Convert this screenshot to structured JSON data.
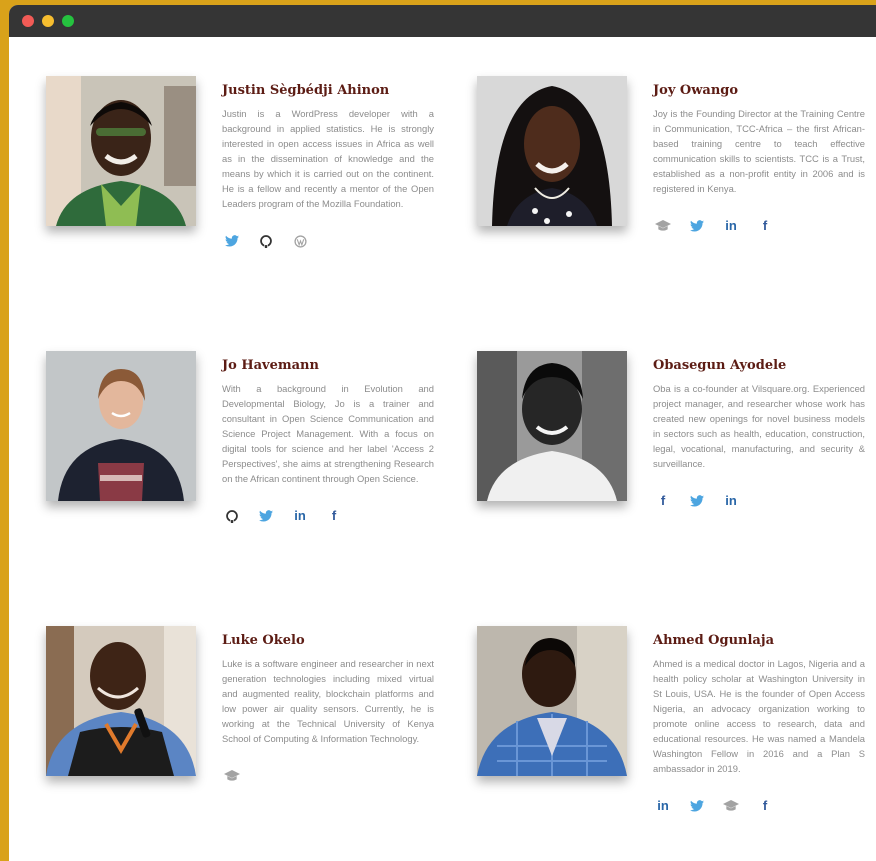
{
  "window": {
    "controls": [
      "close",
      "minimize",
      "maximize"
    ]
  },
  "colors": {
    "twitter": "#4da5e0",
    "linkedin": "#2a67a8",
    "facebook": "#325a9b",
    "dark": "#333333",
    "gray": "#a3a3a3",
    "name": "#5c1c14"
  },
  "people": [
    {
      "name": "Justin Sègbédji Ahinon",
      "bio": "Justin is a WordPress developer with a background in applied statistics. He is strongly interested in open access issues in Africa as well as in the dissemination of knowledge and the means by which it is carried out on the continent. He is a fellow and recently a mentor of the Open Leaders program of the Mozilla Foundation.",
      "socials": [
        {
          "icon": "twitter-icon"
        },
        {
          "icon": "github-icon"
        },
        {
          "icon": "wordpress-icon"
        }
      ]
    },
    {
      "name": "Joy Owango",
      "bio": "Joy is the Founding Director at the Training Centre in Communication, TCC-Africa – the first African-based training centre to teach effective communication skills to scientists. TCC is a Trust, established as a non-profit entity in 2006 and is registered in Kenya.",
      "socials": [
        {
          "icon": "graduation-cap-icon"
        },
        {
          "icon": "twitter-icon"
        },
        {
          "icon": "linkedin-icon",
          "text": "in"
        },
        {
          "icon": "facebook-icon",
          "text": "f"
        }
      ]
    },
    {
      "name": "Jo Havemann",
      "bio": "With a background in Evolution and Developmental Biology, Jo is a trainer and consultant in Open Science Communication and Science Project Management. With a focus on digital tools for science and her label 'Access 2 Perspectives', she aims at strengthening Research on the African continent through Open Science.",
      "socials": [
        {
          "icon": "github-icon"
        },
        {
          "icon": "twitter-icon"
        },
        {
          "icon": "linkedin-icon",
          "text": "in"
        },
        {
          "icon": "facebook-icon",
          "text": "f"
        }
      ]
    },
    {
      "name": "Obasegun Ayodele",
      "bio": "Oba is a co-founder at Vilsquare.org. Experienced project manager, and researcher whose work has created new openings for novel business models in sectors such as health, education, construction, legal, vocational, manufacturing, and security & surveillance.",
      "socials": [
        {
          "icon": "facebook-icon",
          "text": "f"
        },
        {
          "icon": "twitter-icon"
        },
        {
          "icon": "linkedin-icon",
          "text": "in"
        }
      ]
    },
    {
      "name": "Luke Okelo",
      "bio": "Luke is a software engineer and researcher in next generation technologies including mixed virtual and augmented reality, blockchain platforms and low power air quality sensors. Currently, he is working at the Technical University of Kenya School of Computing & Information Technology.",
      "socials": [
        {
          "icon": "graduation-cap-icon"
        }
      ]
    },
    {
      "name": "Ahmed Ogunlaja",
      "bio": "Ahmed is a medical doctor in Lagos, Nigeria and a health policy scholar at Washington University in St Louis, USA. He is the founder of Open Access Nigeria, an advocacy organization working to promote online access to research, data and educational resources. He was named a Mandela Washington Fellow in 2016 and a Plan S ambassador in 2019.",
      "socials": [
        {
          "icon": "linkedin-icon",
          "text": "in"
        },
        {
          "icon": "twitter-icon"
        },
        {
          "icon": "graduation-cap-icon"
        },
        {
          "icon": "facebook-icon",
          "text": "f"
        }
      ]
    }
  ]
}
